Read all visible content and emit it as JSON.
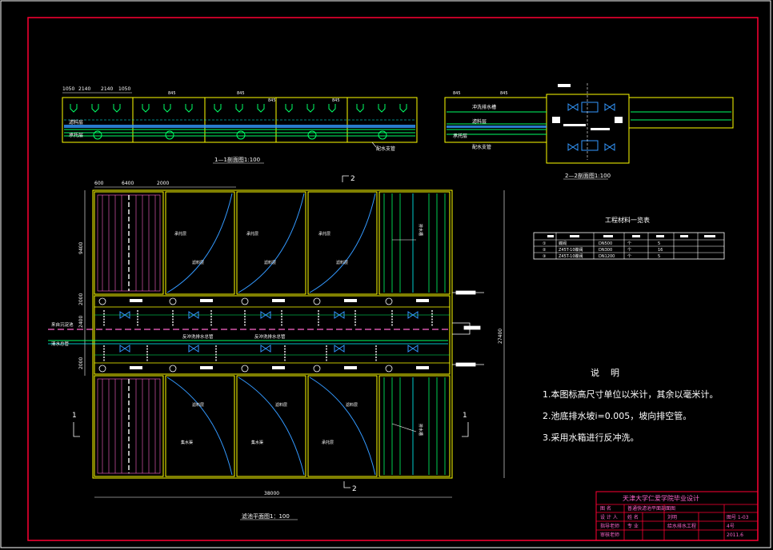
{
  "colors": {
    "background": "#000000",
    "frame": "#ff0033",
    "outline": "#ffff00",
    "pipe": "#00ff66",
    "water": "#00ffff",
    "valve": "#3399ff",
    "text": "#ffffff",
    "label": "#ff66cc",
    "curve": "#3399ff"
  },
  "section_1": {
    "dims": [
      "1050",
      "2140",
      "2140",
      "1050"
    ],
    "levels": [
      "845",
      "845",
      "845",
      "845",
      "800"
    ],
    "labels": {
      "filter_layer": "滤料层",
      "support_layer": "承托层",
      "outlet_pipe": "配水支管"
    },
    "title": "1—1剖面图1:100"
  },
  "section_2": {
    "levels": [
      "845",
      "845"
    ],
    "labels": {
      "backwash_trough": "冲洗排水槽",
      "filter_layer": "滤料层",
      "support_layer": "承托层",
      "outlet_pipe": "配水支管"
    },
    "title": "2—2剖面图1:100"
  },
  "plan": {
    "top_dims": [
      "600",
      "6400",
      "2000"
    ],
    "left_dims": [
      "9400",
      "2000",
      "2400",
      "2000"
    ],
    "right_dim": "27400",
    "bottom_dim": "38000",
    "section_marks": {
      "top": "2",
      "bottom": "2",
      "left": "1",
      "right": "1"
    },
    "cell_labels": {
      "sand": "承托层",
      "filter": "滤料层",
      "drain": "集水渠",
      "trough": "排水槽"
    },
    "gallery_labels": [
      "反冲洗排水总管",
      "反冲洗排水总管"
    ],
    "inlet_label": "来自沉淀池",
    "outlet_label": "清水总管",
    "title": "滤池平面图1：100"
  },
  "materials_table": {
    "title": "工程材料一览表",
    "headers": [
      "",
      "",
      "",
      "",
      "",
      "",
      ""
    ],
    "rows": [
      [
        "①",
        "蝶阀",
        "DN500",
        "个",
        "5",
        "",
        ""
      ],
      [
        "②",
        "Z45T-10蝶阀",
        "DN300",
        "个",
        "16",
        "",
        ""
      ],
      [
        "③",
        "Z45T-10蝶阀",
        "DN1200",
        "个",
        "5",
        "",
        ""
      ]
    ]
  },
  "notes": {
    "title": "说    明",
    "items": [
      "1.本图标高尺寸单位以米计，其余以毫米计。",
      "2.池底排水坡i=0.005，坡向排空管。",
      "3.采用水箱进行反冲洗。"
    ]
  },
  "title_block": {
    "school": "天津大学仁爱学院毕业设计",
    "rows": [
      [
        "图  名",
        "普通快滤池平面剖面图",
        "",
        ""
      ],
      [
        "设 计 人",
        "姓  名",
        "刘明",
        "图号  1-03"
      ],
      [
        "指导老师",
        "专  业",
        "给水排水工程",
        "4号"
      ],
      [
        "审核老师",
        "",
        "",
        "2011.6"
      ]
    ]
  }
}
